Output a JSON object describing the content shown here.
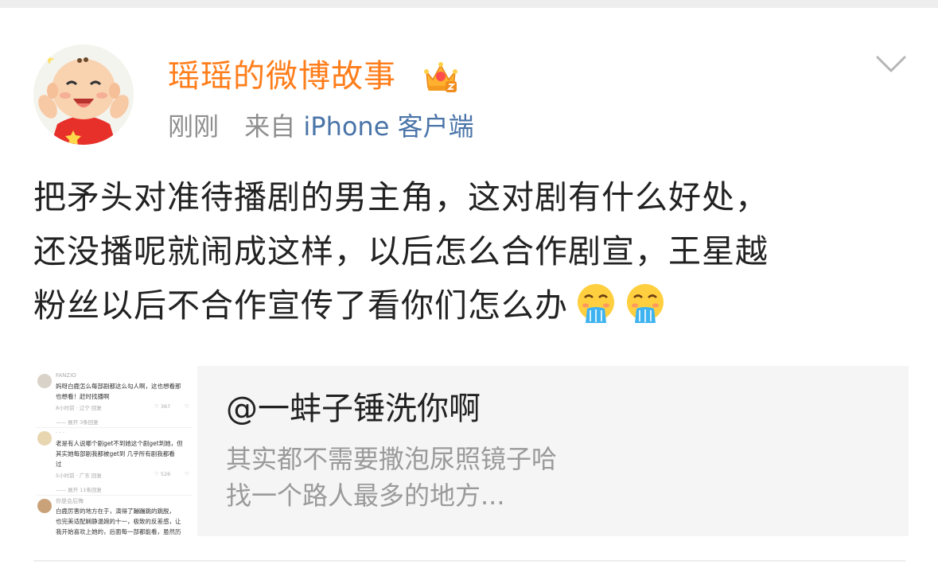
{
  "post": {
    "username": "瑶瑶的微博故事",
    "time": "刚刚",
    "source_prefix": "来自",
    "source_client": "iPhone 客户端",
    "text_lines": [
      "把矛头对准待播剧的男主角，这对剧有什么好处，",
      "还没播呢就闹成这样，以后怎么合作剧宣，王星越",
      "粉丝以后不合作宣传了看你们怎么办"
    ],
    "emoji_icons": [
      "vomiting-face-icon",
      "vomiting-face-icon"
    ]
  },
  "card": {
    "title": "@一蚌子锤洗你啊",
    "desc_lines": [
      "其实都不需要撒泡尿照镜子哈",
      "找一个路人最多的地方..."
    ],
    "thumbnail": {
      "comments": [
        {
          "user": "FANZIO",
          "lines": [
            "妈呀白鹿怎么每部剧都这么勾人啊，这也想看那",
            "也想看！赶时找播啊"
          ],
          "meta": "8小时前 · 辽宁    回复",
          "likes": "367",
          "replies": "—— 展开 3条回复"
        },
        {
          "user": "· · ·",
          "lines": [
            "老是有人说哪个剧get不到她这个剧get到她，但",
            "其实她每部剧我都被get到 几乎所有剧我都看",
            "过"
          ],
          "meta": "5小时前 · 广东    回复",
          "likes": "526",
          "replies": "—— 展开 11条回复"
        },
        {
          "user": "你是会后悔",
          "lines": [
            "白鹿厉害的地方在于，演得了蹦蹦跳的跳脱，",
            "也完美适配娴静温婉的十一，极致的反差感，让",
            "我开始喜欢上她的，后面每一部都能看，虽然历"
          ],
          "meta": "",
          "likes": "",
          "replies": ""
        }
      ]
    }
  },
  "colors": {
    "username": "#ff7d1a",
    "meta": "#8e8e8e",
    "source_link": "#4a74a8",
    "text": "#222222",
    "card_bg": "#f5f5f5",
    "card_desc": "#9a9a9a"
  }
}
